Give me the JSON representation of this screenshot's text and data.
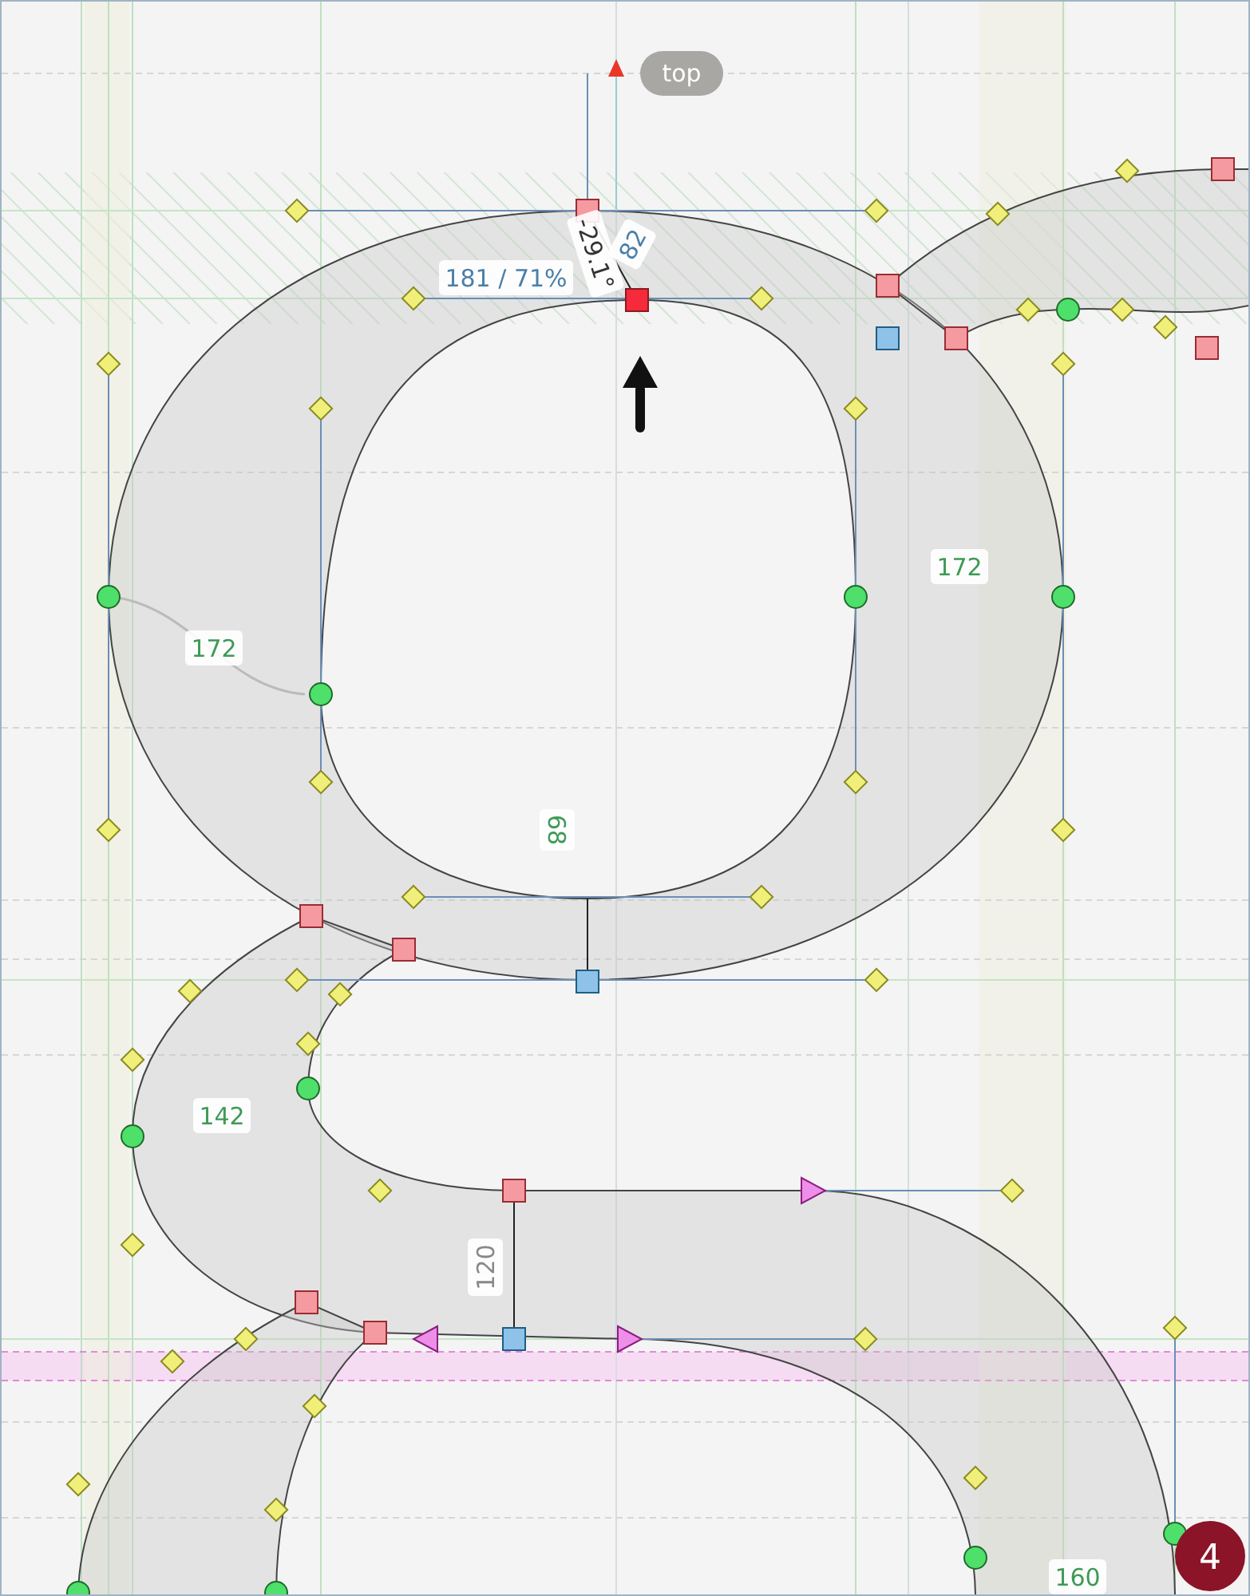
{
  "anchor_label": {
    "text": "top"
  },
  "measurements": [
    {
      "text": "181 / 71%",
      "color": "#4a7fa8",
      "kind": "horizontal"
    },
    {
      "text": "-29.1°",
      "color": "#333333",
      "kind": "angled"
    },
    {
      "text": "82",
      "color": "#4a7fa8",
      "kind": "angled"
    },
    {
      "text": "172",
      "color": "#3e9a56",
      "kind": "horizontal"
    },
    {
      "text": "172",
      "color": "#3e9a56",
      "kind": "horizontal"
    },
    {
      "text": "68",
      "color": "#3e9a56",
      "kind": "vertical"
    },
    {
      "text": "142",
      "color": "#3e9a56",
      "kind": "horizontal"
    },
    {
      "text": "120",
      "color": "#888888",
      "kind": "vertical"
    },
    {
      "text": "160",
      "color": "#3e9a56",
      "kind": "horizontal"
    }
  ],
  "badge": {
    "text": "4"
  }
}
